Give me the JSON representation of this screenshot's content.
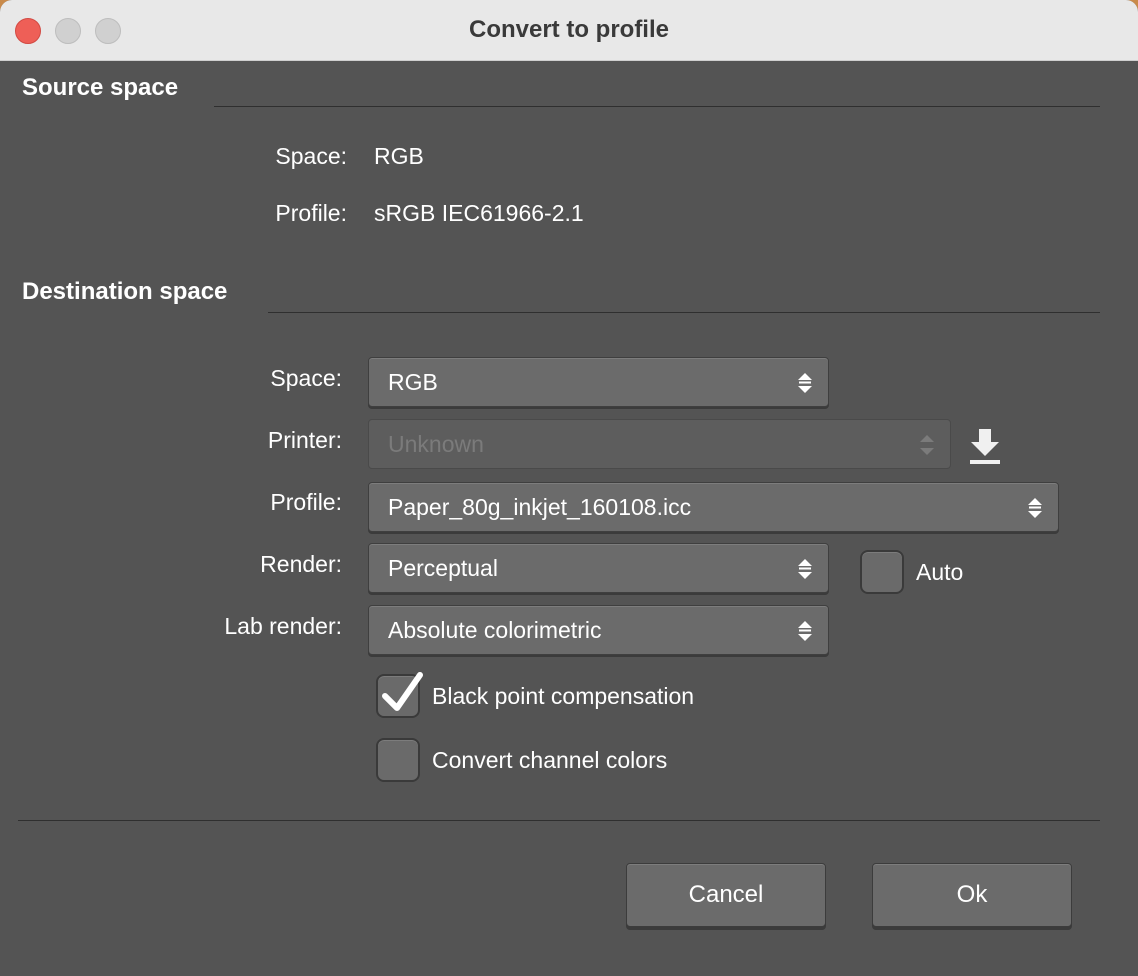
{
  "window": {
    "title": "Convert to profile"
  },
  "source": {
    "heading": "Source space",
    "space_label": "Space:",
    "space_value": "RGB",
    "profile_label": "Profile:",
    "profile_value": "sRGB IEC61966-2.1"
  },
  "destination": {
    "heading": "Destination space",
    "space_label": "Space:",
    "space_value": "RGB",
    "printer_label": "Printer:",
    "printer_value": "Unknown",
    "profile_label": "Profile:",
    "profile_value": "Paper_80g_inkjet_160108.icc",
    "render_label": "Render:",
    "render_value": "Perceptual",
    "auto_label": "Auto",
    "auto_checked": false,
    "lab_render_label": "Lab render:",
    "lab_render_value": "Absolute colorimetric",
    "black_point_label": "Black point compensation",
    "black_point_checked": true,
    "convert_channel_label": "Convert channel colors",
    "convert_channel_checked": false
  },
  "buttons": {
    "cancel": "Cancel",
    "ok": "Ok"
  },
  "icons": {
    "close": "close-icon",
    "minimize": "minimize-icon",
    "maximize": "maximize-icon",
    "spinner": "updown-chevron-icon",
    "download": "download-icon",
    "checkmark": "checkmark-icon"
  },
  "colors": {
    "background": "#545454",
    "close_button": "#ee5f57",
    "text": "#ffffff"
  }
}
